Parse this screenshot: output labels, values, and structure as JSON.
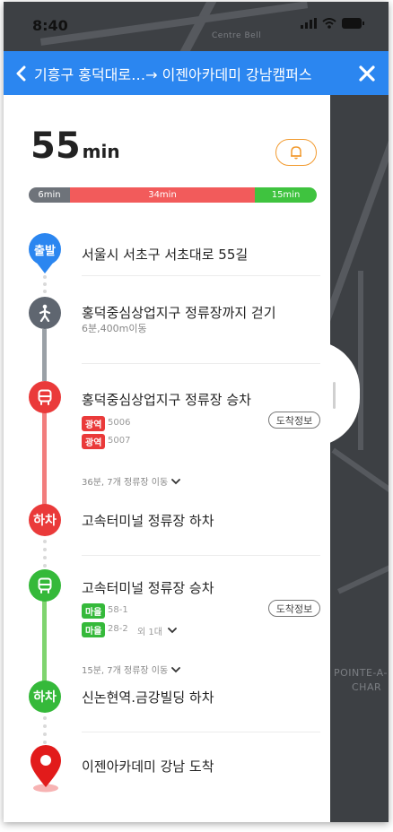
{
  "status": {
    "time": "8:40"
  },
  "map": {
    "label_top": "Centre Bell",
    "label_right_1": "POINTE-A-",
    "label_right_2": "CHAR"
  },
  "header": {
    "route": "기흥구 홍덕대로…→  이젠아카데미 강남캠퍼스",
    "back_icon": "chevron-left-icon",
    "close_icon": "close-icon",
    "color": "#2b86f0"
  },
  "summary": {
    "total_num": "55",
    "total_unit": "min"
  },
  "timebar": {
    "walk": "6min",
    "bus": "34min",
    "local": "15min"
  },
  "colors": {
    "walk": "#6e737a",
    "express_bus": "#f25b5b",
    "local_bus": "#3fc33f",
    "destination": "#e21b1b"
  },
  "steps": {
    "start": {
      "badge": "출발",
      "title": "서울시 서초구 서초대로 55길"
    },
    "walk": {
      "title": "홍덕중심상업지구 정류장까지 걷기",
      "sub": "6분,400m이동"
    },
    "board1": {
      "title": "홍덕중심상업지구 정류장 승차",
      "arrival_info": "도착정보",
      "routes": [
        {
          "type": "광역",
          "num": "5006"
        },
        {
          "type": "광역",
          "num": "5007"
        }
      ],
      "expand": "36분, 7개 정류장 이동"
    },
    "alight1": {
      "badge": "하차",
      "title": "고속터미널 정류장 하차"
    },
    "board2": {
      "title": "고속터미널 정류장 승차",
      "arrival_info": "도착정보",
      "routes": [
        {
          "type": "마을",
          "num": "58-1"
        },
        {
          "type": "마을",
          "num": "28-2",
          "extra": "외 1대"
        }
      ],
      "expand": "15분, 7개 정류장 이동"
    },
    "alight2": {
      "badge": "하차",
      "title": "신논현역.금강빌딩 하차"
    },
    "arrive": {
      "title": "이젠아카데미 강남 도착"
    }
  }
}
